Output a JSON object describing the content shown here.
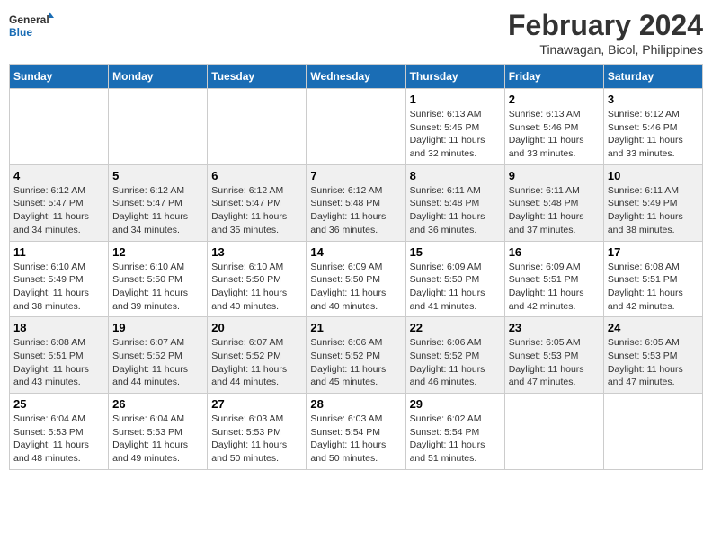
{
  "logo": {
    "line1": "General",
    "line2": "Blue"
  },
  "title": "February 2024",
  "subtitle": "Tinawagan, Bicol, Philippines",
  "days_of_week": [
    "Sunday",
    "Monday",
    "Tuesday",
    "Wednesday",
    "Thursday",
    "Friday",
    "Saturday"
  ],
  "weeks": [
    [
      {
        "day": "",
        "info": ""
      },
      {
        "day": "",
        "info": ""
      },
      {
        "day": "",
        "info": ""
      },
      {
        "day": "",
        "info": ""
      },
      {
        "day": "1",
        "info": "Sunrise: 6:13 AM\nSunset: 5:45 PM\nDaylight: 11 hours\nand 32 minutes."
      },
      {
        "day": "2",
        "info": "Sunrise: 6:13 AM\nSunset: 5:46 PM\nDaylight: 11 hours\nand 33 minutes."
      },
      {
        "day": "3",
        "info": "Sunrise: 6:12 AM\nSunset: 5:46 PM\nDaylight: 11 hours\nand 33 minutes."
      }
    ],
    [
      {
        "day": "4",
        "info": "Sunrise: 6:12 AM\nSunset: 5:47 PM\nDaylight: 11 hours\nand 34 minutes."
      },
      {
        "day": "5",
        "info": "Sunrise: 6:12 AM\nSunset: 5:47 PM\nDaylight: 11 hours\nand 34 minutes."
      },
      {
        "day": "6",
        "info": "Sunrise: 6:12 AM\nSunset: 5:47 PM\nDaylight: 11 hours\nand 35 minutes."
      },
      {
        "day": "7",
        "info": "Sunrise: 6:12 AM\nSunset: 5:48 PM\nDaylight: 11 hours\nand 36 minutes."
      },
      {
        "day": "8",
        "info": "Sunrise: 6:11 AM\nSunset: 5:48 PM\nDaylight: 11 hours\nand 36 minutes."
      },
      {
        "day": "9",
        "info": "Sunrise: 6:11 AM\nSunset: 5:48 PM\nDaylight: 11 hours\nand 37 minutes."
      },
      {
        "day": "10",
        "info": "Sunrise: 6:11 AM\nSunset: 5:49 PM\nDaylight: 11 hours\nand 38 minutes."
      }
    ],
    [
      {
        "day": "11",
        "info": "Sunrise: 6:10 AM\nSunset: 5:49 PM\nDaylight: 11 hours\nand 38 minutes."
      },
      {
        "day": "12",
        "info": "Sunrise: 6:10 AM\nSunset: 5:50 PM\nDaylight: 11 hours\nand 39 minutes."
      },
      {
        "day": "13",
        "info": "Sunrise: 6:10 AM\nSunset: 5:50 PM\nDaylight: 11 hours\nand 40 minutes."
      },
      {
        "day": "14",
        "info": "Sunrise: 6:09 AM\nSunset: 5:50 PM\nDaylight: 11 hours\nand 40 minutes."
      },
      {
        "day": "15",
        "info": "Sunrise: 6:09 AM\nSunset: 5:50 PM\nDaylight: 11 hours\nand 41 minutes."
      },
      {
        "day": "16",
        "info": "Sunrise: 6:09 AM\nSunset: 5:51 PM\nDaylight: 11 hours\nand 42 minutes."
      },
      {
        "day": "17",
        "info": "Sunrise: 6:08 AM\nSunset: 5:51 PM\nDaylight: 11 hours\nand 42 minutes."
      }
    ],
    [
      {
        "day": "18",
        "info": "Sunrise: 6:08 AM\nSunset: 5:51 PM\nDaylight: 11 hours\nand 43 minutes."
      },
      {
        "day": "19",
        "info": "Sunrise: 6:07 AM\nSunset: 5:52 PM\nDaylight: 11 hours\nand 44 minutes."
      },
      {
        "day": "20",
        "info": "Sunrise: 6:07 AM\nSunset: 5:52 PM\nDaylight: 11 hours\nand 44 minutes."
      },
      {
        "day": "21",
        "info": "Sunrise: 6:06 AM\nSunset: 5:52 PM\nDaylight: 11 hours\nand 45 minutes."
      },
      {
        "day": "22",
        "info": "Sunrise: 6:06 AM\nSunset: 5:52 PM\nDaylight: 11 hours\nand 46 minutes."
      },
      {
        "day": "23",
        "info": "Sunrise: 6:05 AM\nSunset: 5:53 PM\nDaylight: 11 hours\nand 47 minutes."
      },
      {
        "day": "24",
        "info": "Sunrise: 6:05 AM\nSunset: 5:53 PM\nDaylight: 11 hours\nand 47 minutes."
      }
    ],
    [
      {
        "day": "25",
        "info": "Sunrise: 6:04 AM\nSunset: 5:53 PM\nDaylight: 11 hours\nand 48 minutes."
      },
      {
        "day": "26",
        "info": "Sunrise: 6:04 AM\nSunset: 5:53 PM\nDaylight: 11 hours\nand 49 minutes."
      },
      {
        "day": "27",
        "info": "Sunrise: 6:03 AM\nSunset: 5:53 PM\nDaylight: 11 hours\nand 50 minutes."
      },
      {
        "day": "28",
        "info": "Sunrise: 6:03 AM\nSunset: 5:54 PM\nDaylight: 11 hours\nand 50 minutes."
      },
      {
        "day": "29",
        "info": "Sunrise: 6:02 AM\nSunset: 5:54 PM\nDaylight: 11 hours\nand 51 minutes."
      },
      {
        "day": "",
        "info": ""
      },
      {
        "day": "",
        "info": ""
      }
    ]
  ]
}
